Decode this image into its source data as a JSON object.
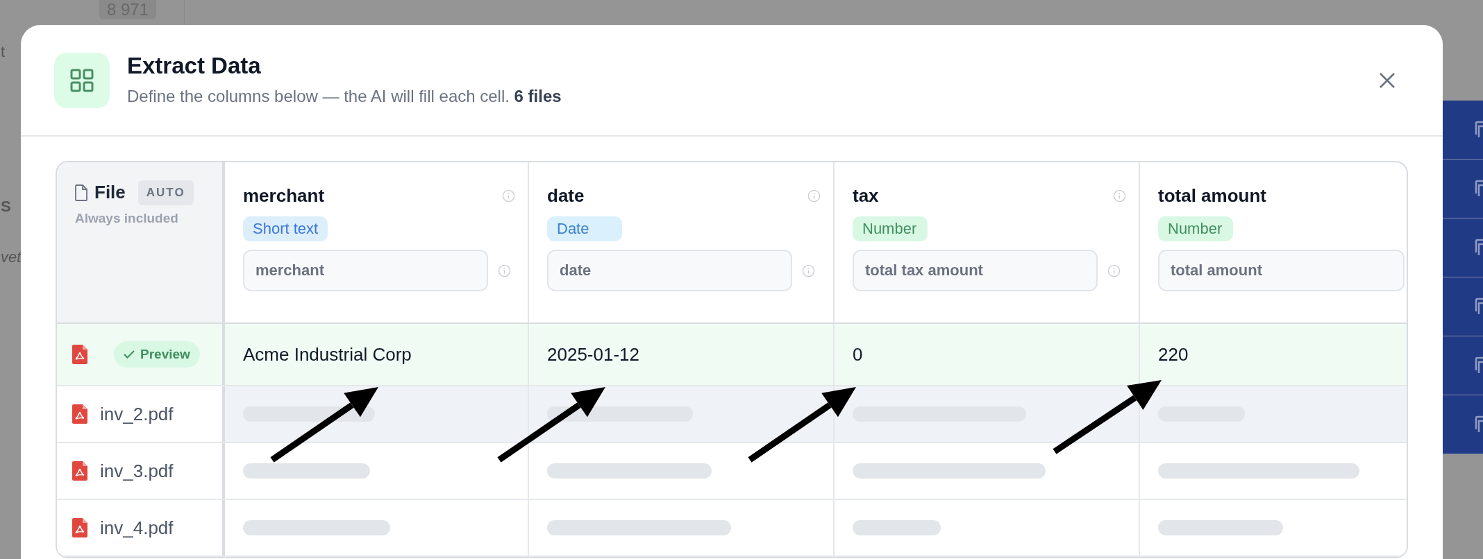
{
  "background": {
    "count_badge": "8 971",
    "sidebar_fragments": [
      {
        "text": "t",
        "kind": "plain"
      },
      {
        "text": "S",
        "kind": "bold"
      },
      {
        "text": "vet",
        "kind": "italic"
      }
    ]
  },
  "dialog": {
    "title": "Extract Data",
    "subtitle": "Define the columns below — the AI will fill each cell. **6 files**",
    "file_column": {
      "title": "File",
      "badge": "AUTO",
      "note": "Always included"
    },
    "columns": [
      {
        "name": "merchant",
        "type": "Short text",
        "color": "#3a78d6",
        "description": "merchant"
      },
      {
        "name": "date",
        "type": "Date",
        "color": "#3d82c8",
        "description": "date"
      },
      {
        "name": "tax",
        "type": "Number",
        "color": "#3f8f5f",
        "description": "total tax amount"
      },
      {
        "name": "total amount",
        "type": "Number",
        "color": "#3f8f5f",
        "description": "total amount"
      }
    ],
    "rows": [
      {
        "kind": "preview",
        "badge": "Preview",
        "values": [
          "Acme Industrial Corp",
          "2025-01-12",
          "0",
          "220"
        ],
        "highlighted": false
      },
      {
        "kind": "pending",
        "file": "inv_2.pdf",
        "highlighted": true
      },
      {
        "kind": "pending",
        "file": "inv_3.pdf",
        "highlighted": false
      },
      {
        "kind": "pending",
        "file": "inv_4.pdf",
        "highlighted": false
      }
    ]
  }
}
